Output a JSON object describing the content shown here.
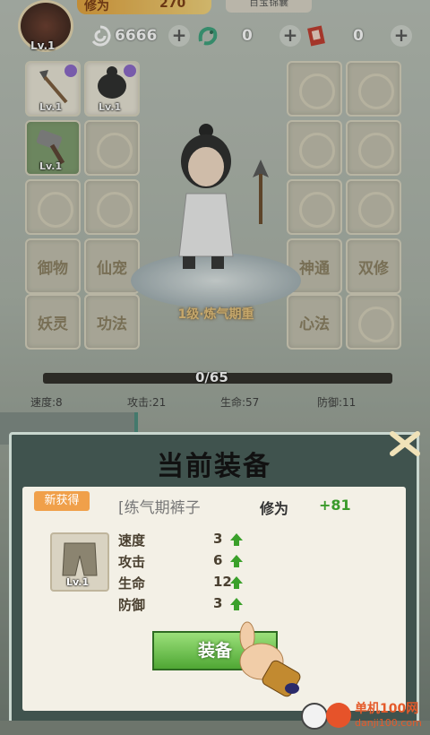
{
  "top": {
    "level": "Lv.1",
    "cultivation_label": "修为",
    "cultivation_value": "270",
    "unlock_label": "百宝锦囊",
    "resources": [
      {
        "icon": "spirit-stone-icon",
        "value": "6666"
      },
      {
        "icon": "jade-dragon-icon",
        "value": "0"
      },
      {
        "icon": "scroll-ticket-icon",
        "value": "0"
      }
    ]
  },
  "left_slots": [
    {
      "type": "item",
      "lv": "Lv.1",
      "icon": "spear-icon"
    },
    {
      "type": "item",
      "lv": "Lv.1",
      "icon": "hair-icon"
    },
    {
      "type": "item",
      "lv": "Lv.1",
      "icon": "hammer-icon"
    },
    {
      "type": "empty"
    },
    {
      "type": "empty"
    },
    {
      "type": "empty"
    },
    {
      "type": "label",
      "label": "御物"
    },
    {
      "type": "label",
      "label": "仙宠"
    },
    {
      "type": "label",
      "label": "妖灵"
    },
    {
      "type": "label",
      "label": "功法"
    }
  ],
  "right_slots": [
    {
      "type": "empty"
    },
    {
      "type": "empty"
    },
    {
      "type": "empty"
    },
    {
      "type": "empty"
    },
    {
      "type": "empty"
    },
    {
      "type": "empty"
    },
    {
      "type": "label",
      "label": "神通"
    },
    {
      "type": "label",
      "label": "双修"
    },
    {
      "type": "label",
      "label": "心法"
    },
    {
      "type": "empty"
    }
  ],
  "hero": {
    "realm": "1级·炼气期重"
  },
  "exp": {
    "text": "0/65",
    "fraction": 0.0
  },
  "stats": [
    {
      "label": "速度:8"
    },
    {
      "label": "攻击:21"
    },
    {
      "label": "生命:57"
    },
    {
      "label": "防御:11"
    }
  ],
  "modal": {
    "title": "当前装备",
    "badge": "新获得",
    "item_name": "[练气期裤子",
    "item_lv": "Lv.1",
    "cultivation_label": "修为",
    "cultivation_gain": "+81",
    "rows": [
      {
        "name": "速度",
        "value": "3"
      },
      {
        "name": "攻击",
        "value": "6"
      },
      {
        "name": "生命",
        "value": "12"
      },
      {
        "name": "防御",
        "value": "3"
      }
    ],
    "equip_label": "装备"
  },
  "watermark": {
    "line1": "单机100网",
    "line2": "danji100.com"
  },
  "colors": {
    "accent_green": "#4fa734",
    "gain_green": "#3a9a2a",
    "badge_orange": "#f0a04a"
  }
}
